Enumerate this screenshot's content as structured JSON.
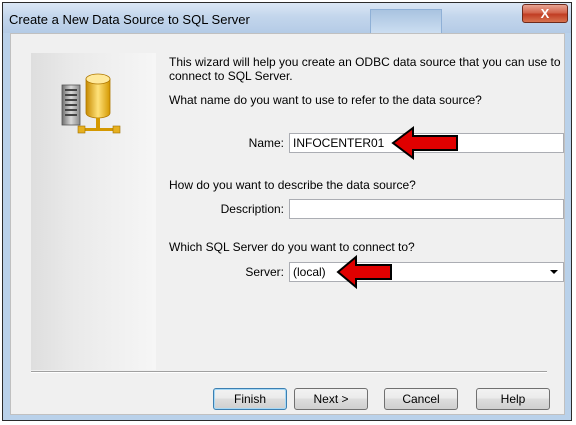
{
  "window": {
    "title": "Create a New Data Source to SQL Server",
    "close_glyph": "X"
  },
  "wizard": {
    "intro": "This wizard will help you create an ODBC data source that you can use to connect to SQL Server.",
    "intro_line1": "This wizard will help you create an ODBC data source that you can use to",
    "intro_line2": "connect to SQL Server.",
    "name_question": "What name do you want to use to refer to the data source?",
    "name_label": "Name:",
    "name_value": "INFOCENTER01",
    "description_question": "How do you want to describe the data source?",
    "description_label": "Description:",
    "description_value": "",
    "server_question": "Which SQL Server do you want to connect to?",
    "server_label": "Server:",
    "server_value": "(local)"
  },
  "buttons": {
    "finish": "Finish",
    "next": "Next >",
    "cancel": "Cancel",
    "help": "Help"
  },
  "icons": [
    "database-server-icon",
    "close-icon",
    "chevron-down-icon",
    "red-arrow-icon"
  ],
  "colors": {
    "annotation_arrow": "#e00000",
    "title_bar": "#c3d6ec",
    "close_button": "#c13d24"
  }
}
